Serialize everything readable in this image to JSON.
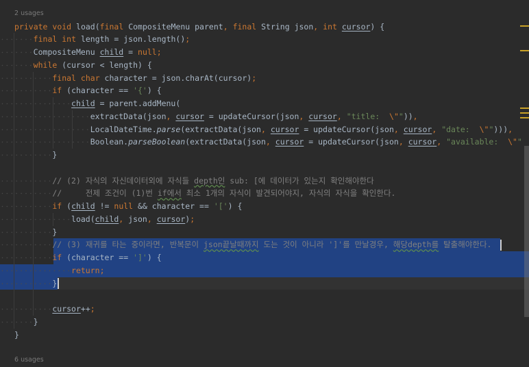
{
  "editor": {
    "colors": {
      "background": "#2b2b2b",
      "keyword": "#cc7832",
      "text": "#a9b7c6",
      "string": "#6a8759",
      "comment": "#808080",
      "selection": "#214283",
      "marker": "#c9a227"
    },
    "inlay_top": "2 usages",
    "inlay_bottom": "6 usages",
    "lines": [
      {
        "indent": 0,
        "text": "private void load(final CompositeMenu parent, final String json, int cursor) {",
        "underline": [
          "cursor"
        ]
      },
      {
        "indent": 1,
        "text": "final int length = json.length();"
      },
      {
        "indent": 1,
        "text": "CompositeMenu child = null;",
        "underline": [
          "child"
        ]
      },
      {
        "indent": 1,
        "text": "while (cursor < length) {"
      },
      {
        "indent": 2,
        "text": "final char character = json.charAt(cursor);"
      },
      {
        "indent": 2,
        "text": "if (character == '{') {"
      },
      {
        "indent": 3,
        "text": "child = parent.addMenu(",
        "underline": [
          "child"
        ]
      },
      {
        "indent": 4,
        "text": "extractData(json, cursor = updateCursor(json, cursor, \"title:  \\\"\")),",
        "underline": [
          "cursor"
        ]
      },
      {
        "indent": 4,
        "text": "LocalDateTime.parse(extractData(json, cursor = updateCursor(json, cursor, \"date:  \\\"\"))),",
        "underline": [
          "cursor"
        ],
        "italic": [
          "parse"
        ]
      },
      {
        "indent": 4,
        "text": "Boolean.parseBoolean(extractData(json, cursor = updateCursor(json, cursor, \"available:  \\\"\"",
        "underline": [
          "cursor"
        ],
        "italic": [
          "parseBoolean"
        ]
      },
      {
        "indent": 2,
        "text": "}"
      },
      {
        "indent": 0,
        "text": ""
      },
      {
        "indent": 2,
        "text": "// (2) 자식의 자신데이터외에 자식들 depth인 sub: [에 데이터가 있는지 확인해야한다",
        "typo": [
          "depth인"
        ]
      },
      {
        "indent": 2,
        "text": "//     전제 조건이 (1)번 if에서 최소 1개의 자식이 발견되어야지, 자식의 자식을 확인한다.",
        "typo": [
          "if에서"
        ]
      },
      {
        "indent": 2,
        "text": "if (child != null && character == '[') {",
        "underline": [
          "child"
        ]
      },
      {
        "indent": 3,
        "text": "load(child, json, cursor);",
        "underline": [
          "child",
          "cursor"
        ]
      },
      {
        "indent": 2,
        "text": "}"
      },
      {
        "indent": 2,
        "text": "// (3) 재귀를 타는 중이라면, 반복문이 json끝날때까지 도는 것이 아니라 ']'를 만날경우, 해당depth를 탈출해야한다.",
        "typo": [
          "json끝날때까지",
          "해당depth를"
        ]
      },
      {
        "indent": 2,
        "text": "if (character == ']') {"
      },
      {
        "indent": 3,
        "text": "return;"
      },
      {
        "indent": 2,
        "text": "}"
      },
      {
        "indent": 0,
        "text": ""
      },
      {
        "indent": 2,
        "text": "cursor++;",
        "underline": [
          "cursor"
        ]
      },
      {
        "indent": 1,
        "text": "}"
      },
      {
        "indent": 0,
        "text": "}"
      }
    ]
  }
}
